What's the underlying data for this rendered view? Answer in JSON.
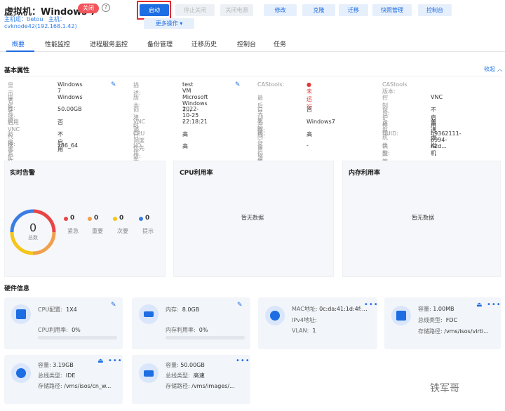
{
  "header": {
    "title": "虚拟机：Windows 7",
    "status_badge": "关闭",
    "help": "?",
    "host_label": "主机组：",
    "host_group": "tietou",
    "host_label2": "主机：",
    "host": "cvknode42(192.168.1.42)"
  },
  "toolbar": {
    "start": "启动",
    "btn2": "停止关闭",
    "btn3": "关闭电源",
    "modify": "修改",
    "clone": "克隆",
    "migrate": "迁移",
    "snapshot": "快照管理",
    "console": "控制台",
    "more": "更多操作 ▾"
  },
  "tabs": [
    "概要",
    "性能监控",
    "进程服务监控",
    "备份管理",
    "迁移历史",
    "控制台",
    "任务"
  ],
  "basic": {
    "title": "基本属性",
    "collapse": "收起 ︿",
    "col1": [
      {
        "label": "显示名称:",
        "value": "Windows 7"
      },
      {
        "label": "操作系统:",
        "value": "Windows"
      },
      {
        "label": "存储:",
        "value": "50.00GB"
      },
      {
        "label": "启用VNC代理:",
        "value": "否"
      },
      {
        "label": "防病毒配置:",
        "value": "不启用"
      },
      {
        "label": "体系结构:",
        "value": "x86_64"
      }
    ],
    "col2": [
      {
        "label": "描述:",
        "value": "test VM"
      },
      {
        "label": "版本:",
        "value": "Microsoft Windows 7..."
      },
      {
        "label": "创建时间:",
        "value": "2022-10-25 22:18:21"
      },
      {
        "label": "VNC端口:",
        "value": "-"
      },
      {
        "label": "CPU调度优先级:",
        "value": "高"
      },
      {
        "label": "I/O优先级:",
        "value": "高"
      }
    ],
    "col3": [
      {
        "label": "CAStools:",
        "value": "● 未运行"
      },
      {
        "label": "最后关机时间:",
        "value": ""
      },
      {
        "label": "自动迁移:",
        "value": "否"
      },
      {
        "label": "名称:",
        "value": "Windows7"
      },
      {
        "label": "内存资源优先级:",
        "value": "高"
      },
      {
        "label": "备份策略",
        "value": "-"
      }
    ],
    "col4": [
      {
        "label": "CAStools 版本:",
        "value": ""
      },
      {
        "label": "控制台:",
        "value": "VNC"
      },
      {
        "label": "保护模式:",
        "value": "不启用"
      },
      {
        "label": "虚拟机类型:",
        "value": "普通虚拟机"
      },
      {
        "label": "UUID:",
        "value": "b9362111-b994-42d..."
      },
      {
        "label": "快照策略",
        "value": "-"
      }
    ]
  },
  "alerts": {
    "title": "实时告警",
    "total": "0",
    "total_label": "总数",
    "items": [
      {
        "count": "0",
        "label": "紧急",
        "color": "#e84545"
      },
      {
        "count": "0",
        "label": "重要",
        "color": "#f0a04b"
      },
      {
        "count": "0",
        "label": "次要",
        "color": "#f5c518"
      },
      {
        "count": "0",
        "label": "提示",
        "color": "#3a7ee4"
      }
    ]
  },
  "cpu_panel": {
    "title": "CPU利用率",
    "empty": "暂无数据"
  },
  "mem_panel": {
    "title": "内存利用率",
    "empty": "暂无数据"
  },
  "hardware": {
    "title": "硬件信息",
    "cpu": {
      "l1": "CPU配置:",
      "v1": "1X4",
      "l2": "CPU利用率:",
      "v2": "0%"
    },
    "mem": {
      "l1": "内存:",
      "v1": "8.0GB",
      "l2": "内存利用率:",
      "v2": "0%"
    },
    "nic": {
      "l1": "MAC地址:",
      "v1": "0c:da:41:1d:4f:...",
      "l2": "IPv4地址:",
      "v2": "",
      "l3": "VLAN:",
      "v3": "1"
    },
    "floppy": {
      "l1": "容量:",
      "v1": "1.00MB",
      "l2": "总线类型:",
      "v2": "FDC",
      "l3": "存储路径:",
      "v3": "/vms/isos/virti..."
    },
    "cdrom": {
      "l1": "容量:",
      "v1": "3.19GB",
      "l2": "总线类型:",
      "v2": "IDE",
      "l3": "存储路径:",
      "v3": "/vms/isos/cn_w..."
    },
    "disk": {
      "l1": "容量:",
      "v1": "50.00GB",
      "l2": "总线类型:",
      "v2": "高速",
      "l3": "存储路径:",
      "v3": "/vms/images/..."
    }
  },
  "watermark": "铁军哥"
}
